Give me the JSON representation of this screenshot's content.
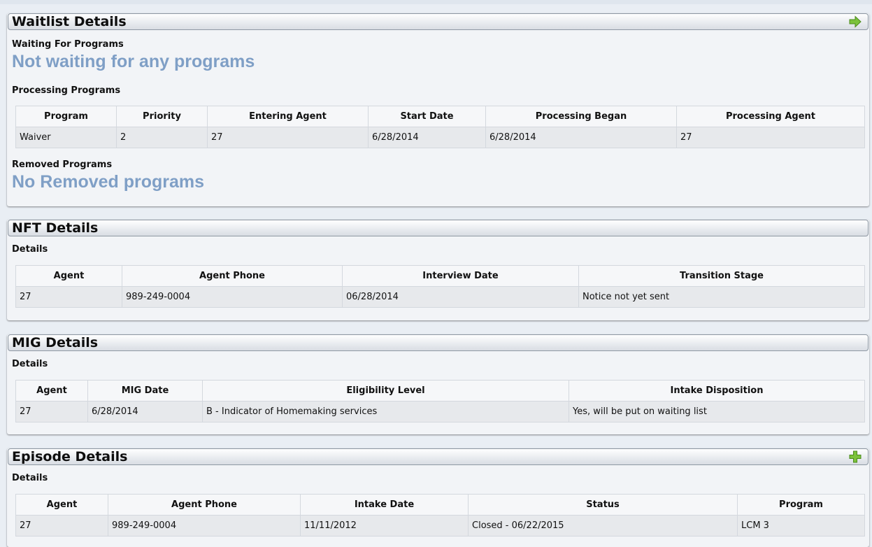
{
  "waitlist": {
    "title": "Waitlist Details",
    "icon": "arrow-right-icon",
    "waiting_heading": "Waiting For Programs",
    "waiting_msg": "Not waiting for any programs",
    "processing_heading": "Processing Programs",
    "columns": [
      "Program",
      "Priority",
      "Entering Agent",
      "Start Date",
      "Processing Began",
      "Processing Agent"
    ],
    "rows": [
      [
        "Waiver",
        "2",
        "27",
        "6/28/2014",
        "6/28/2014",
        "27"
      ]
    ],
    "removed_heading": "Removed Programs",
    "removed_msg": "No Removed programs"
  },
  "nft": {
    "title": "NFT Details",
    "details_heading": "Details",
    "columns": [
      "Agent",
      "Agent Phone",
      "Interview Date",
      "Transition Stage"
    ],
    "rows": [
      [
        "27",
        "989-249-0004",
        "06/28/2014",
        "Notice not yet sent"
      ]
    ]
  },
  "mig": {
    "title": "MIG Details",
    "details_heading": "Details",
    "columns": [
      "Agent",
      "MIG Date",
      "Eligibility Level",
      "Intake Disposition"
    ],
    "rows": [
      [
        "27",
        "6/28/2014",
        "B - Indicator of Homemaking services",
        "Yes, will be put on waiting list"
      ]
    ]
  },
  "episode": {
    "title": "Episode Details",
    "icon": "plus-icon",
    "details_heading": "Details",
    "columns": [
      "Agent",
      "Agent Phone",
      "Intake Date",
      "Status",
      "Program"
    ],
    "rows": [
      [
        "27",
        "989-249-0004",
        "11/11/2012",
        "Closed - 06/22/2015",
        "LCM 3"
      ]
    ]
  },
  "colors": {
    "message": "#7f9fc6",
    "arrow_icon": "#7cc23b",
    "plus_icon": "#7cc23b"
  }
}
